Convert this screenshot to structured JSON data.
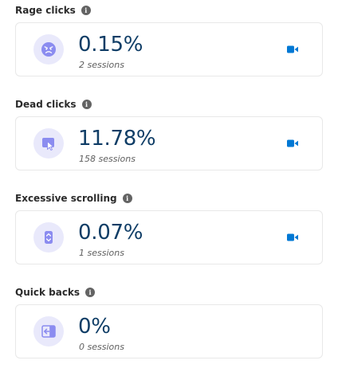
{
  "metrics": [
    {
      "title": "Rage clicks",
      "value": "0.15%",
      "sessions": "2 sessions",
      "icon": "angry-face-icon",
      "has_recording": true
    },
    {
      "title": "Dead clicks",
      "value": "11.78%",
      "sessions": "158 sessions",
      "icon": "cursor-click-icon",
      "has_recording": true
    },
    {
      "title": "Excessive scrolling",
      "value": "0.07%",
      "sessions": "1 sessions",
      "icon": "scroll-icon",
      "has_recording": true
    },
    {
      "title": "Quick backs",
      "value": "0%",
      "sessions": "0 sessions",
      "icon": "back-arrow-icon",
      "has_recording": false
    }
  ],
  "info_glyph": "i",
  "colors": {
    "value_text": "#0f3d66",
    "icon_bg": "#e9e9fb",
    "icon_accent": "#8b8cf0",
    "recording_icon": "#0078d4"
  }
}
